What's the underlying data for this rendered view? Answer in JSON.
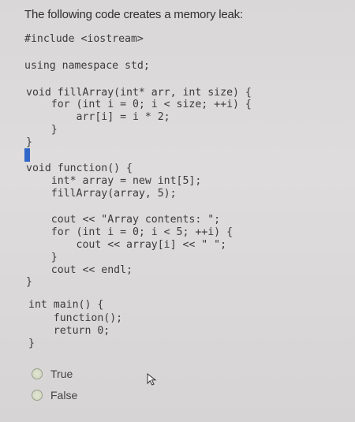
{
  "question": {
    "text": "The following code creates a memory leak:"
  },
  "code": {
    "lines": [
      "#include <iostream>",
      "using namespace std;",
      "void fillArray(int* arr, int size) {",
      "    for (int i = 0; i < size; ++i) {",
      "        arr[i] = i * 2;",
      "    }",
      "}",
      "void function() {",
      "    int* array = new int[5];",
      "    fillArray(array, 5);",
      "    cout << \"Array contents: \";",
      "    for (int i = 0; i < 5; ++i) {",
      "        cout << array[i] << \" \";",
      "    }",
      "    cout << endl;",
      "}",
      "int main() {",
      "    function();",
      "    return 0;",
      "}"
    ]
  },
  "answers": {
    "true_label": "True",
    "false_label": "False"
  },
  "icons": {
    "radio": "radio-button-icon",
    "pointer": "mouse-pointer-icon"
  },
  "colors": {
    "accent": "#2f66c8"
  }
}
